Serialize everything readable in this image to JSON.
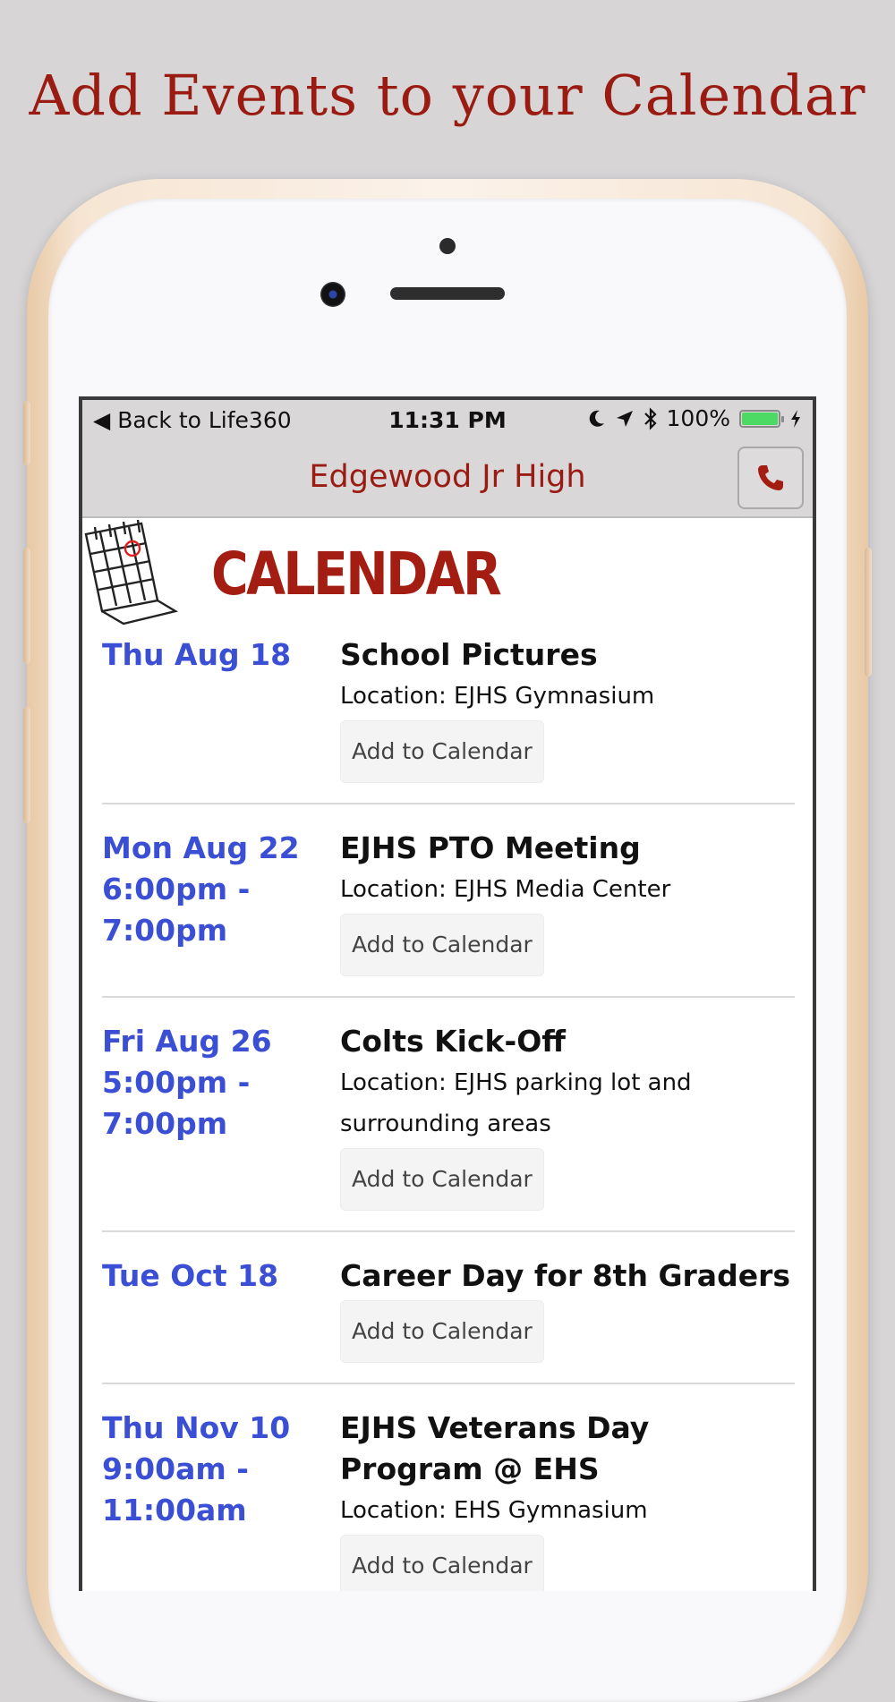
{
  "promo": {
    "headline": "Add Events to your Calendar"
  },
  "status_bar": {
    "back_label": "Back to Life360",
    "time": "11:31 PM",
    "battery_percent": "100%",
    "battery_level": 1.0
  },
  "nav": {
    "title": "Edgewood Jr High"
  },
  "calendar_header": {
    "title": "CALENDAR"
  },
  "colors": {
    "brand_red": "#9a1b12",
    "date_blue": "#3a4fd3",
    "battery_green": "#4cd964"
  },
  "events": [
    {
      "date": "Thu Aug 18",
      "time": "",
      "title": "School Pictures",
      "location": "Location: EJHS Gymnasium",
      "button": "Add to Calendar"
    },
    {
      "date": "Mon Aug 22",
      "time": "6:00pm - 7:00pm",
      "title": "EJHS PTO Meeting",
      "location": "Location: EJHS Media Center",
      "button": "Add to Calendar"
    },
    {
      "date": "Fri Aug 26",
      "time": "5:00pm - 7:00pm",
      "title": "Colts Kick-Off",
      "location": "Location: EJHS parking lot and surrounding areas",
      "button": "Add to Calendar"
    },
    {
      "date": "Tue Oct 18",
      "time": "",
      "title": "Career Day for 8th Graders",
      "location": "",
      "button": "Add to Calendar"
    },
    {
      "date": "Thu Nov 10",
      "time": "9:00am - 11:00am",
      "title": "EJHS Veterans Day Program @ EHS",
      "location": "Location: EHS Gymnasium",
      "button": "Add to Calendar"
    }
  ]
}
